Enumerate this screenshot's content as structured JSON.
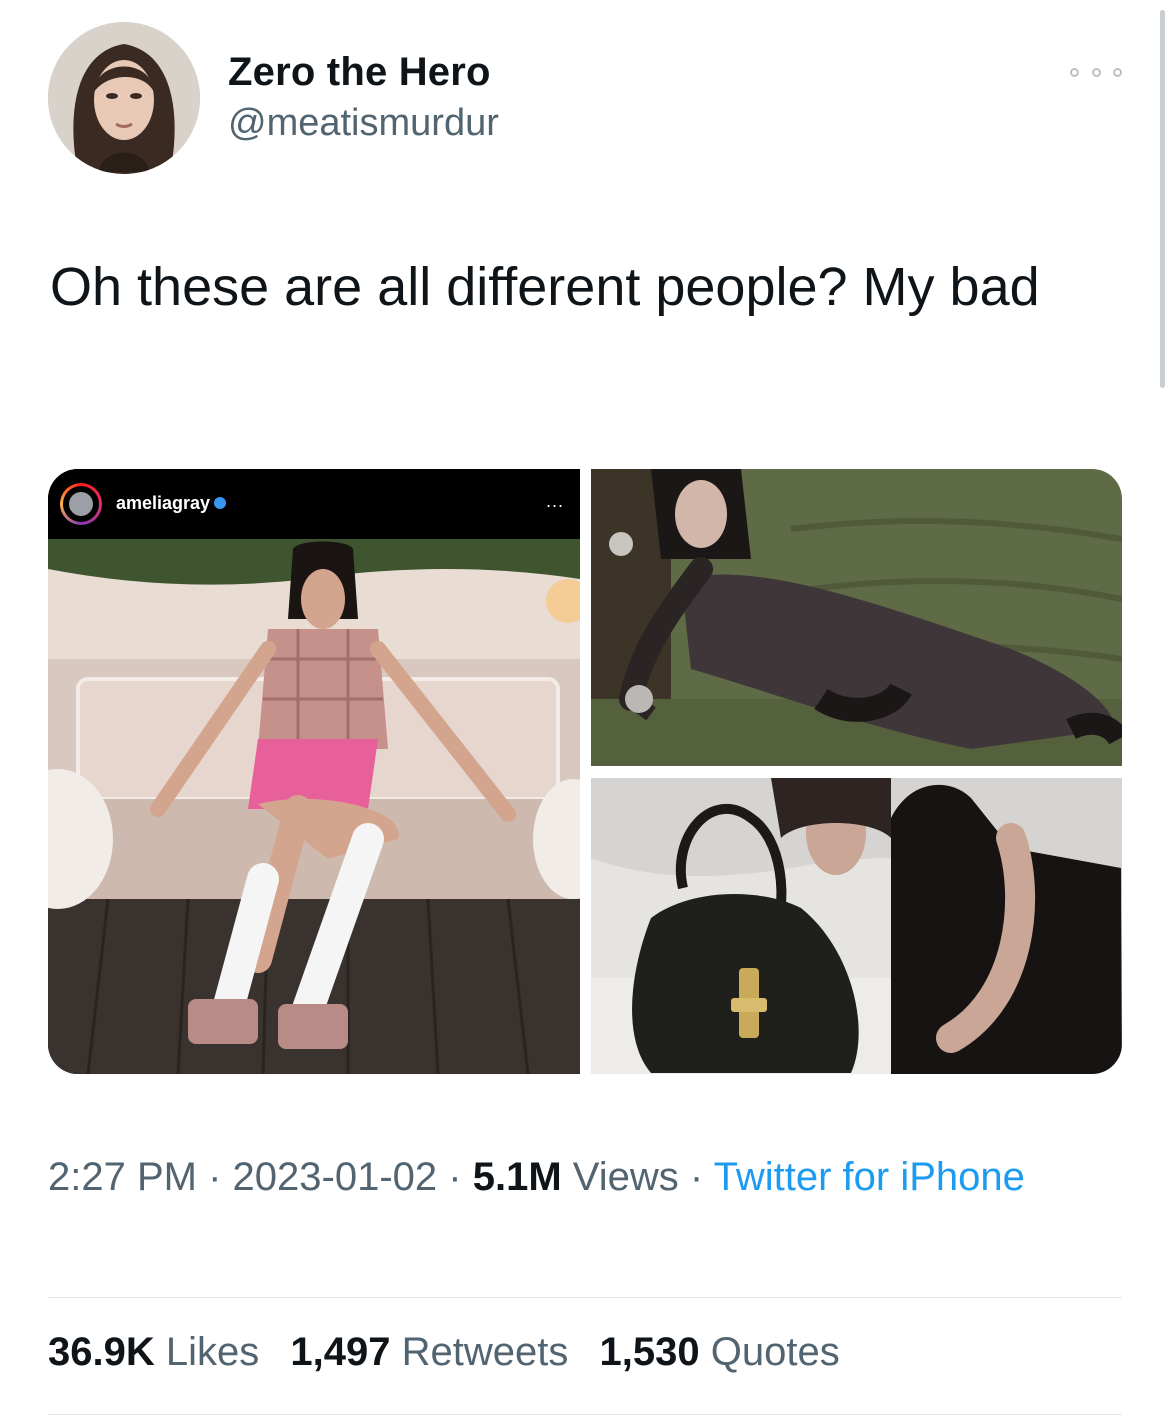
{
  "author": {
    "display_name": "Zero the Hero",
    "handle": "@meatismurdur",
    "avatar_icon": "profile-photo"
  },
  "tweet": {
    "text": "Oh these are all different people? My bad"
  },
  "media": {
    "left": {
      "instagram_username": "ameliagray",
      "instagram_more": "..."
    }
  },
  "meta": {
    "time": "2:27 PM",
    "date": "2023-01-02",
    "views_count": "5.1M",
    "views_label": "Views",
    "source": "Twitter for iPhone",
    "separator": "·"
  },
  "stats": {
    "likes_count": "36.9K",
    "likes_label": "Likes",
    "retweets_count": "1,497",
    "retweets_label": "Retweets",
    "quotes_count": "1,530",
    "quotes_label": "Quotes"
  },
  "colors": {
    "text_primary": "#0f1419",
    "text_secondary": "#536471",
    "link": "#1d9bf0"
  }
}
